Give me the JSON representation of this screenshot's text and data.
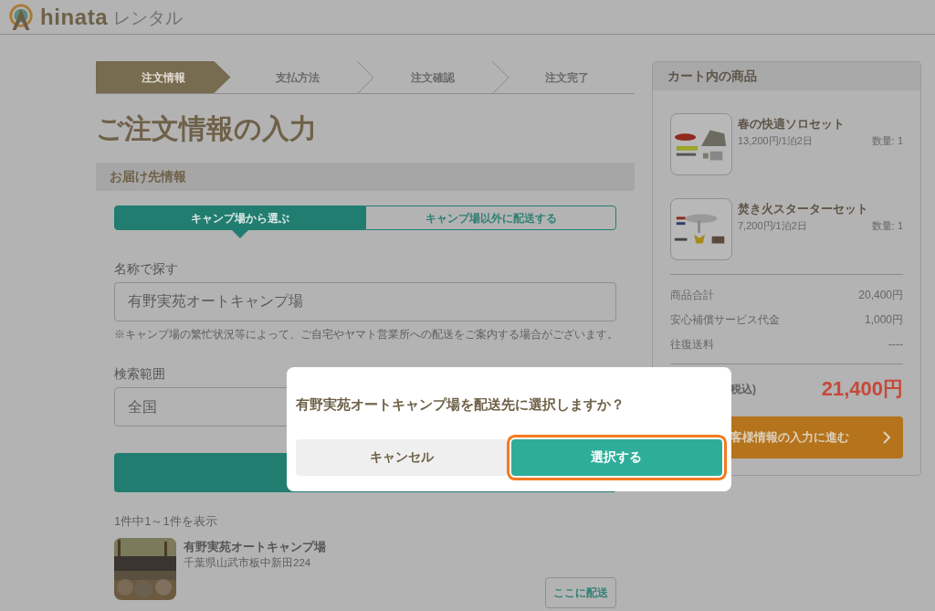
{
  "header": {
    "logo_text": "hinata",
    "logo_sub": "レンタル"
  },
  "steps": [
    {
      "label": "注文情報",
      "selected": true
    },
    {
      "label": "支払方法",
      "selected": false
    },
    {
      "label": "注文確認",
      "selected": false
    },
    {
      "label": "注文完了",
      "selected": false
    }
  ],
  "page_title": "ご注文情報の入力",
  "delivery": {
    "heading": "お届け先情報",
    "tabs": [
      {
        "label": "キャンプ場から選ぶ",
        "selected": true
      },
      {
        "label": "キャンプ場以外に配送する",
        "selected": false
      }
    ],
    "name_label": "名称で探す",
    "name_value": "有野実苑オートキャンプ場",
    "note": "※キャンプ場の繁忙状況等によって、ご自宅やヤマト営業所への配送をご案内する場合がございます。",
    "range_label": "検索範囲",
    "range_value": "全国",
    "result_count": "1件中1～1件を表示",
    "results": [
      {
        "name": "有野実苑オートキャンプ場",
        "address": "千葉県山武市板中新田224",
        "action": "ここに配送"
      }
    ]
  },
  "cart": {
    "title": "カート内の商品",
    "items": [
      {
        "name": "春の快適ソロセット",
        "price": "13,200円/1泊2日",
        "quantity": "数量: 1"
      },
      {
        "name": "焚き火スターターセット",
        "price": "7,200円/1泊2日",
        "quantity": "数量: 1"
      }
    ],
    "summary": [
      {
        "label": "商品合計",
        "value": "20,400円"
      },
      {
        "label": "安心補償サービス代金",
        "value": "1,000円"
      },
      {
        "label": "往復送料",
        "value": "----"
      }
    ],
    "total_label": "税込)",
    "total_value": "21,400円",
    "checkout": "客様情報の入力に進む"
  },
  "dialog": {
    "message": "有野実苑オートキャンプ場を配送先に選択しますか？",
    "buttons": [
      {
        "label": "キャンセル",
        "kind": "cancel",
        "focused": false
      },
      {
        "label": "選択する",
        "kind": "confirm",
        "focused": true
      }
    ]
  }
}
